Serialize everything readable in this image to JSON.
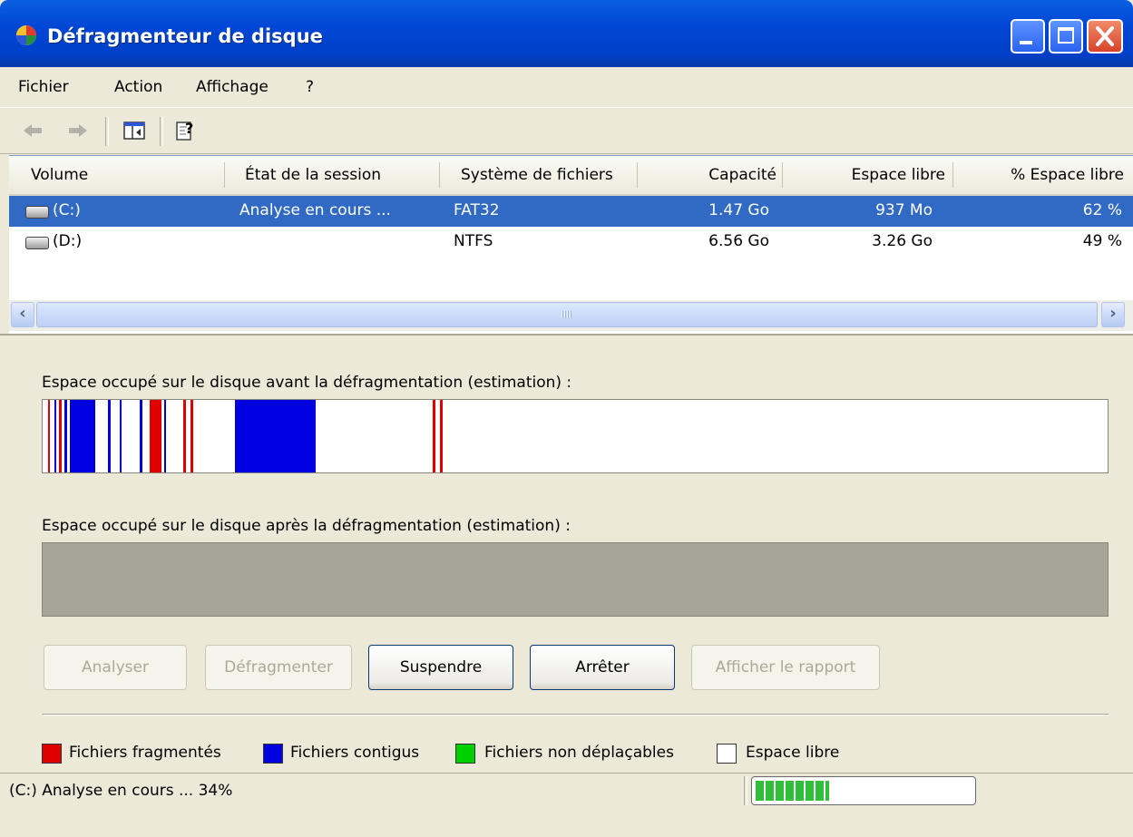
{
  "window": {
    "title": "Défragmenteur de disque"
  },
  "menu": [
    "Fichier",
    "Action",
    "Affichage",
    "?"
  ],
  "list": {
    "headers": [
      "Volume",
      "État de la session",
      "Système de fichiers",
      "Capacité",
      "Espace libre",
      "% Espace libre"
    ],
    "rows": [
      {
        "volume": "(C:)",
        "state": "Analyse en cours ...",
        "fs": "FAT32",
        "capacity": "1.47 Go",
        "free": "937 Mo",
        "pct": "62 %",
        "selected": true
      },
      {
        "volume": "(D:)",
        "state": "",
        "fs": "NTFS",
        "capacity": "6.56 Go",
        "free": "3.26 Go",
        "pct": "49 %",
        "selected": false
      }
    ]
  },
  "before_label": "Espace occupé sur le disque avant la défragmentation (estimation) :",
  "after_label": "Espace occupé sur le disque après la défragmentation (estimation) :",
  "buttons": {
    "analyze": "Analyser",
    "defrag": "Défragmenter",
    "pause": "Suspendre",
    "stop": "Arrêter",
    "report": "Afficher le rapport"
  },
  "legend": [
    {
      "label": "Fichiers fragmentés",
      "color": "#e00000"
    },
    {
      "label": "Fichiers contigus",
      "color": "#0000e0"
    },
    {
      "label": "Fichiers non déplaçables",
      "color": "#00d000"
    },
    {
      "label": "Espace libre",
      "color": "#ffffff"
    }
  ],
  "status": {
    "text": "(C:) Analyse en cours ... 34%",
    "progress_fraction": 0.34
  },
  "colors": {
    "fragmented": "#e00000",
    "contiguous": "#0000e0",
    "selection": "#316ac5"
  },
  "icons": [
    "app-icon",
    "back-arrow-icon",
    "forward-arrow-icon",
    "show-hide-tree-icon",
    "help-icon",
    "drive-icon"
  ]
}
